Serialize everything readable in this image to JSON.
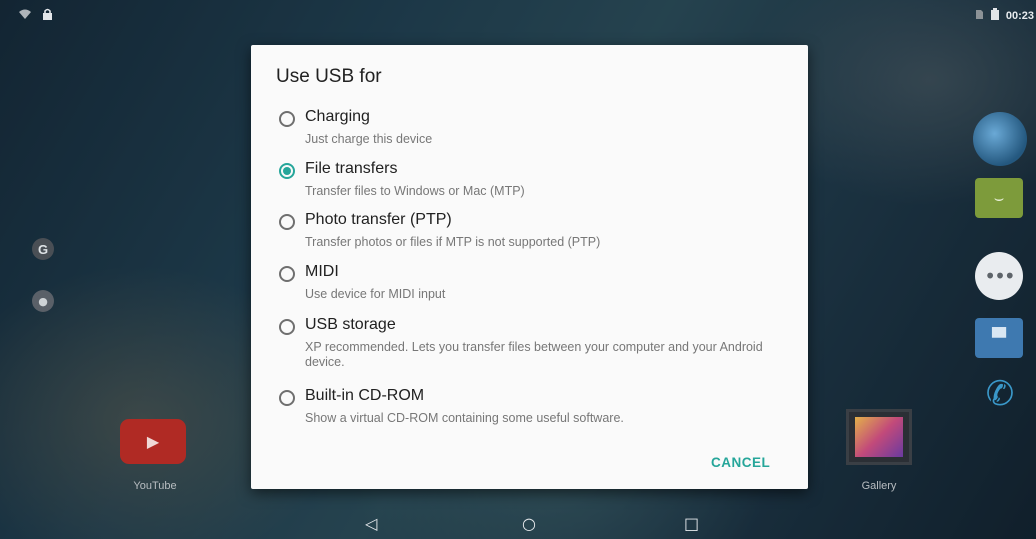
{
  "status_bar": {
    "left_icons": [
      "wifi-icon",
      "lock-icon"
    ],
    "right_icons": [
      "sim-icon",
      "battery-icon"
    ],
    "time": "00:23"
  },
  "home_screen": {
    "apps": [
      {
        "label": "YouTube",
        "icon": "youtube-icon"
      },
      {
        "label": "Gallery",
        "icon": "gallery-icon"
      }
    ],
    "dock_icons": [
      "browser-icon",
      "messaging-icon",
      "app-drawer-icon",
      "contacts-icon",
      "phone-icon"
    ],
    "left_icons": [
      "google-icon",
      "voice-search-icon"
    ]
  },
  "dialog": {
    "title": "Use USB for",
    "selected": "File transfers",
    "accent_color": "#26a69a",
    "options": [
      {
        "label": "Charging",
        "description": "Just charge this device",
        "checked": false
      },
      {
        "label": "File transfers",
        "description": "Transfer files to Windows or Mac (MTP)",
        "checked": true
      },
      {
        "label": "Photo transfer (PTP)",
        "description": "Transfer photos or files if MTP is not supported (PTP)",
        "checked": false
      },
      {
        "label": "MIDI",
        "description": "Use device for MIDI input",
        "checked": false
      },
      {
        "label": "USB storage",
        "description": "XP recommended. Lets you transfer files between your computer and your Android device.",
        "checked": false
      },
      {
        "label": "Built-in CD-ROM",
        "description": "Show a virtual CD-ROM containing some useful software.",
        "checked": false
      }
    ],
    "cancel_label": "CANCEL"
  },
  "nav_bar": {
    "back": "◁",
    "home": "○",
    "recents": "□"
  }
}
